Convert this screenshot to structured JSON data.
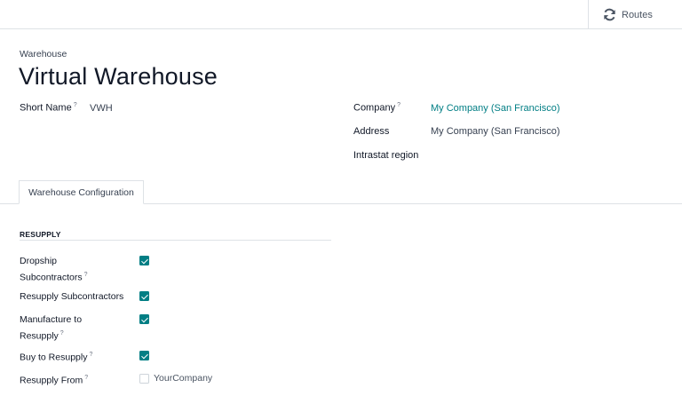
{
  "topbar": {
    "routes_label": "Routes",
    "routes_icon": "refresh-icon"
  },
  "header": {
    "breadcrumb": "Warehouse",
    "title": "Virtual Warehouse"
  },
  "fields": {
    "short_name": {
      "label": "Short Name",
      "help": "?",
      "value": "VWH"
    },
    "company": {
      "label": "Company",
      "help": "?",
      "value": "My Company (San Francisco)"
    },
    "address": {
      "label": "Address",
      "value": "My Company (San Francisco)"
    },
    "intrastat": {
      "label": "Intrastat region",
      "value": ""
    }
  },
  "tabs": [
    {
      "label": "Warehouse Configuration",
      "active": true
    }
  ],
  "resupply": {
    "section_title": "RESUPPLY",
    "rows": [
      {
        "label_line1": "Dropship",
        "label_line2": "Subcontractors",
        "help": "?",
        "checked": true
      },
      {
        "label": "Resupply Subcontractors",
        "checked": true
      },
      {
        "label_line1": "Manufacture to",
        "label_line2": "Resupply",
        "help": "?",
        "checked": true
      },
      {
        "label": "Buy to Resupply",
        "help": "?",
        "checked": true
      },
      {
        "label": "Resupply From",
        "help": "?",
        "option": "YourCompany",
        "checked": false
      }
    ]
  },
  "colors": {
    "accent": "#017e84",
    "border": "#dee2e6",
    "text": "#111827"
  }
}
